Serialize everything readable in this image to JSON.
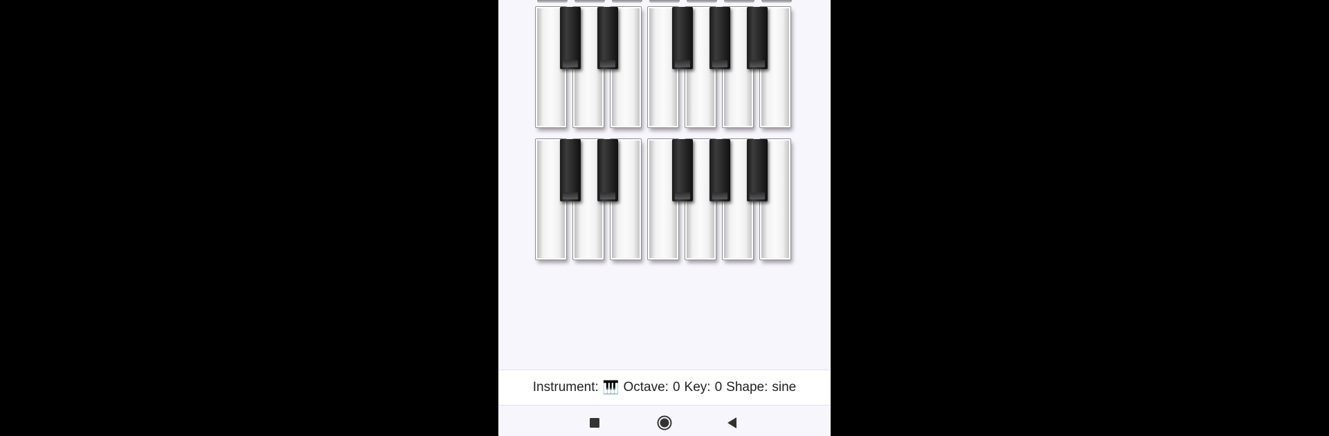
{
  "status": {
    "instrument_label": "Instrument:",
    "instrument_value": "🎹",
    "octave_label": "Octave:",
    "octave_value": "0",
    "key_label": "Key:",
    "key_value": "0",
    "shape_label": "Shape:",
    "shape_value": "sine"
  },
  "keyboards": [
    {
      "name": "keyboard-row-1",
      "white_keys": 7,
      "black_keys": 5
    },
    {
      "name": "keyboard-row-2",
      "white_keys": 7,
      "black_keys": 5
    }
  ],
  "navigation": {
    "buttons": [
      "recents-icon",
      "home-icon",
      "back-icon"
    ]
  },
  "colors": {
    "screen_background": "#f8f6fd",
    "black_key": "#1a1a1a",
    "white_key": "#f5f5f5"
  }
}
